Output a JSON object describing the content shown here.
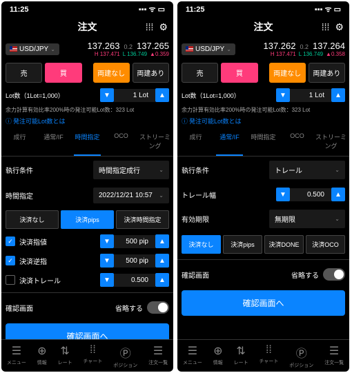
{
  "left": {
    "status": {
      "time": "11:25"
    },
    "header": {
      "title": "注文"
    },
    "pair": {
      "name": "USD/JPY"
    },
    "prices": {
      "bid": "137.263",
      "spread": "0.2",
      "ask": "137.265",
      "high": "137.471",
      "low": "136.749",
      "change": "0.359"
    },
    "buttons": {
      "sell": "売",
      "buy": "買",
      "cross_off": "両建なし",
      "cross_on": "両建あり"
    },
    "lot": {
      "label": "Lot数（1Lot=1,000）",
      "value": "1 Lot"
    },
    "margin_text": "余力計算有効比率200%時の発注可能Lot数：323 Lot",
    "link": "発注可能Lot数とは",
    "tabs": {
      "t1": "成行",
      "t2": "通常/IF",
      "t3": "時間指定",
      "t4": "OCO",
      "t5": "ストリーミング"
    },
    "exec_cond": {
      "label": "執行条件",
      "value": "時間指定成行"
    },
    "time_spec": {
      "label": "時間指定",
      "value": "2022/12/21 10:57"
    },
    "seg": {
      "s1": "決済なし",
      "s2": "決済pips",
      "s3": "決済時間指定"
    },
    "rows": {
      "r1": {
        "label": "決済指値",
        "value": "500 pip"
      },
      "r2": {
        "label": "決済逆指",
        "value": "500 pip"
      },
      "r3": {
        "label": "決済トレール",
        "value": "0.500"
      }
    },
    "confirm": {
      "label": "確認画面",
      "toggle_text": "省略する"
    },
    "confirm_btn": "確認画面へ",
    "nav": {
      "n1": "メニュー",
      "n2": "情報",
      "n3": "レート",
      "n4": "チャート",
      "n5": "ポジション",
      "n6": "注文一覧"
    }
  },
  "right": {
    "status": {
      "time": "11:25"
    },
    "header": {
      "title": "注文"
    },
    "pair": {
      "name": "USD/JPY"
    },
    "prices": {
      "bid": "137.262",
      "spread": "0.2",
      "ask": "137.264",
      "high": "137.471",
      "low": "136.749",
      "change": "0.358"
    },
    "buttons": {
      "sell": "売",
      "buy": "買",
      "cross_off": "両建なし",
      "cross_on": "両建あり"
    },
    "lot": {
      "label": "Lot数（1Lot=1,000）",
      "value": "1 Lot"
    },
    "margin_text": "余力計算有効比率200%時の発注可能Lot数：323 Lot",
    "link": "発注可能Lot数とは",
    "tabs": {
      "t1": "成行",
      "t2": "通常/IF",
      "t3": "時間指定",
      "t4": "OCO",
      "t5": "ストリーミング"
    },
    "exec_cond": {
      "label": "執行条件",
      "value": "トレール"
    },
    "trail": {
      "label": "トレール幅",
      "value": "0.500"
    },
    "expiry": {
      "label": "有効期限",
      "value": "無期限"
    },
    "seg": {
      "s1": "決済なし",
      "s2": "決済pips",
      "s3": "決済DONE",
      "s4": "決済OCO"
    },
    "confirm": {
      "label": "確認画面",
      "toggle_text": "省略する"
    },
    "confirm_btn": "確認画面へ",
    "nav": {
      "n1": "メニュー",
      "n2": "情報",
      "n3": "レート",
      "n4": "チャート",
      "n5": "ポジション",
      "n6": "注文一覧"
    }
  }
}
